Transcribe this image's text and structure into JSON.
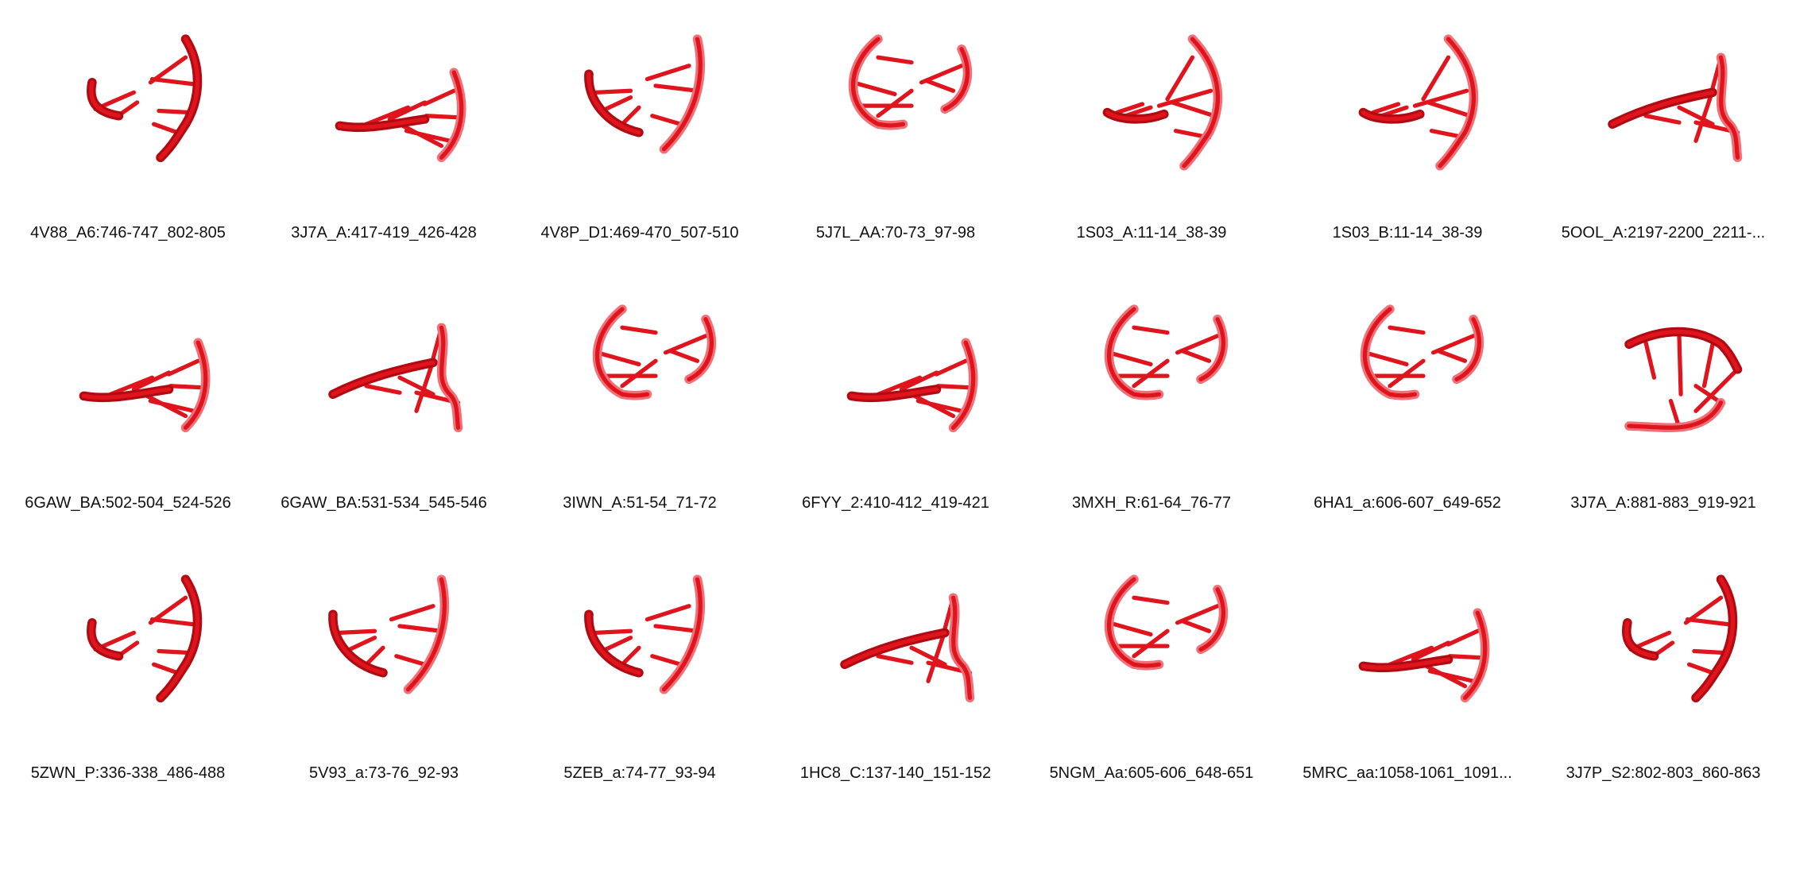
{
  "grid": {
    "rows": 3,
    "columns": 7,
    "structure_color": "#e0141c",
    "items": [
      {
        "label": "4V88_A6:746-747_802-805",
        "icon": "rna-backbone-structure"
      },
      {
        "label": "3J7A_A:417-419_426-428",
        "icon": "rna-backbone-structure"
      },
      {
        "label": "4V8P_D1:469-470_507-510",
        "icon": "rna-backbone-structure"
      },
      {
        "label": "5J7L_AA:70-73_97-98",
        "icon": "rna-backbone-structure"
      },
      {
        "label": "1S03_A:11-14_38-39",
        "icon": "rna-backbone-structure"
      },
      {
        "label": "1S03_B:11-14_38-39",
        "icon": "rna-backbone-structure"
      },
      {
        "label": "5OOL_A:2197-2200_2211-...",
        "icon": "rna-backbone-structure"
      },
      {
        "label": "6GAW_BA:502-504_524-526",
        "icon": "rna-backbone-structure"
      },
      {
        "label": "6GAW_BA:531-534_545-546",
        "icon": "rna-backbone-structure"
      },
      {
        "label": "3IWN_A:51-54_71-72",
        "icon": "rna-backbone-structure"
      },
      {
        "label": "6FYY_2:410-412_419-421",
        "icon": "rna-backbone-structure"
      },
      {
        "label": "3MXH_R:61-64_76-77",
        "icon": "rna-backbone-structure"
      },
      {
        "label": "6HA1_a:606-607_649-652",
        "icon": "rna-backbone-structure"
      },
      {
        "label": "3J7A_A:881-883_919-921",
        "icon": "rna-backbone-structure"
      },
      {
        "label": "5ZWN_P:336-338_486-488",
        "icon": "rna-backbone-structure"
      },
      {
        "label": "5V93_a:73-76_92-93",
        "icon": "rna-backbone-structure"
      },
      {
        "label": "5ZEB_a:74-77_93-94",
        "icon": "rna-backbone-structure"
      },
      {
        "label": "1HC8_C:137-140_151-152",
        "icon": "rna-backbone-structure"
      },
      {
        "label": "5NGM_Aa:605-606_648-651",
        "icon": "rna-backbone-structure"
      },
      {
        "label": "5MRC_aa:1058-1061_1091...",
        "icon": "rna-backbone-structure"
      },
      {
        "label": "3J7P_S2:802-803_860-863",
        "icon": "rna-backbone-structure"
      }
    ]
  }
}
